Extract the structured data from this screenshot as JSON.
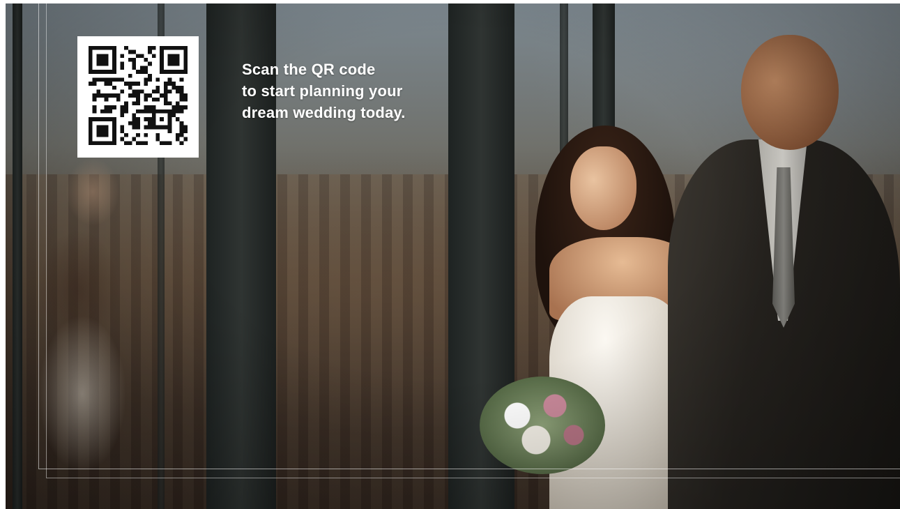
{
  "promo": {
    "lines": [
      "Scan the QR code",
      "to start planning your",
      "dream wedding today."
    ]
  },
  "qr": {
    "icon": "qr-code-icon",
    "module_color": "#111111",
    "background_color": "#ffffff"
  },
  "colors": {
    "text": "#ffffff",
    "guide_lines": "#ffffff"
  }
}
